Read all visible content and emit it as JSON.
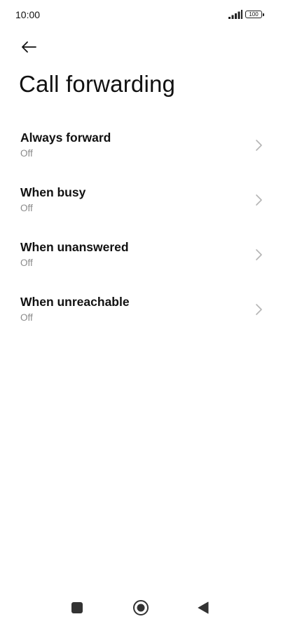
{
  "status_bar": {
    "time": "10:00",
    "battery": "100"
  },
  "header": {
    "back_icon": "arrow-left-icon",
    "title": "Call forwarding"
  },
  "items": [
    {
      "title": "Always forward",
      "subtitle": "Off"
    },
    {
      "title": "When busy",
      "subtitle": "Off"
    },
    {
      "title": "When unanswered",
      "subtitle": "Off"
    },
    {
      "title": "When unreachable",
      "subtitle": "Off"
    }
  ],
  "nav": {
    "recents_icon": "square-icon",
    "home_icon": "circle-icon",
    "back_icon": "triangle-back-icon"
  },
  "colors": {
    "background": "#ffffff",
    "title_text": "#111111",
    "subtitle_text": "#8a8a8a",
    "chevron": "#b5b5b5"
  }
}
